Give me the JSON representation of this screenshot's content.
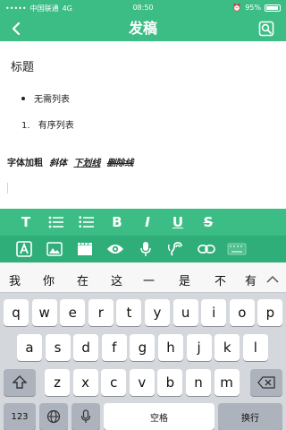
{
  "status_bar": {
    "carrier": "中国联通",
    "network": "4G",
    "time": "08:50",
    "battery": "95%",
    "battery_level": 0.95
  },
  "nav": {
    "title": "发稿",
    "icons": {
      "back": "back-chevron-icon",
      "preview": "preview-search-icon"
    }
  },
  "editor": {
    "heading": "标题",
    "unordered_item": "无需列表",
    "ordered_number": "1.",
    "ordered_item": "有序列表",
    "rich_bold": "字体加粗",
    "rich_italic": "斜体",
    "rich_underline": "下划线",
    "rich_strike": "删除线"
  },
  "toolbar_row1": {
    "heading_label": "T",
    "bold_label": "B",
    "italic_label": "I",
    "underline_label": "U",
    "strike_label": "S",
    "icons": [
      "heading-icon",
      "unordered-list-icon",
      "ordered-list-icon",
      "bold-icon",
      "italic-icon",
      "underline-icon",
      "strikethrough-icon"
    ]
  },
  "toolbar_row2": {
    "icons": [
      "font-icon",
      "image-icon",
      "video-icon",
      "preview-eye-icon",
      "microphone-icon",
      "audio-icon",
      "link-icon",
      "keyboard-icon"
    ]
  },
  "keyboard": {
    "candidates": [
      "我",
      "你",
      "在",
      "这",
      "一",
      "是",
      "不",
      "有"
    ],
    "row1": [
      "q",
      "w",
      "e",
      "r",
      "t",
      "y",
      "u",
      "i",
      "o",
      "p"
    ],
    "row2": [
      "a",
      "s",
      "d",
      "f",
      "g",
      "h",
      "j",
      "k",
      "l"
    ],
    "row3": [
      "z",
      "x",
      "c",
      "v",
      "b",
      "n",
      "m"
    ],
    "num_key": "123",
    "space_key": "空格",
    "return_key": "换行"
  },
  "colors": {
    "brand_green": "#3cbd85",
    "toolbar_dark_green": "#2fae79",
    "keyboard_bg": "#d4d7dc"
  }
}
